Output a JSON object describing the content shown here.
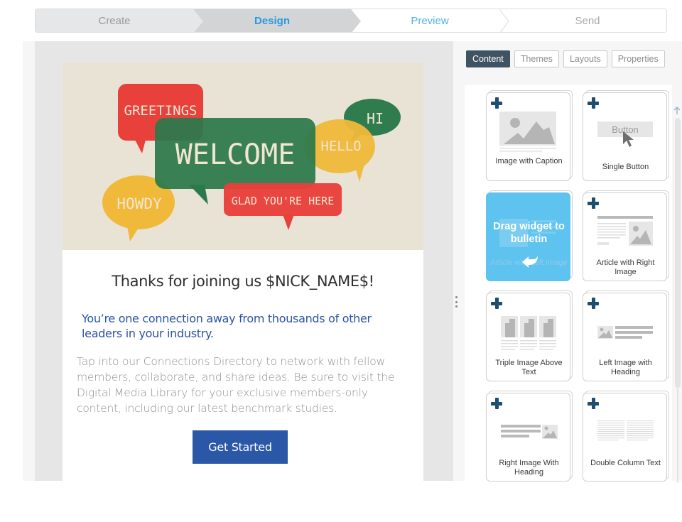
{
  "stepper": {
    "steps": [
      {
        "label": "Create",
        "state": "completed"
      },
      {
        "label": "Design",
        "state": "active"
      },
      {
        "label": "Preview",
        "state": "next"
      },
      {
        "label": "Send",
        "state": "upcoming"
      }
    ]
  },
  "email": {
    "hero_image": {
      "alt": "Welcome speech bubbles",
      "bubbles": [
        "GREETINGS",
        "WELCOME",
        "HELLO",
        "HI",
        "HOWDY",
        "GLAD YOU'RE HERE"
      ]
    },
    "title": "Thanks for joining us $NICK_NAME$!",
    "subtitle": "You’re one connection away from thousands of other leaders in your industry.",
    "body": "Tap into our Connections Directory to network with fellow members, collaborate, and share ideas. Be sure to visit the Digital Media Library for your exclusive members-only content, including our latest benchmark studies.",
    "cta_label": "Get Started"
  },
  "panel": {
    "tabs": [
      {
        "label": "Content",
        "active": true
      },
      {
        "label": "Themes",
        "active": false
      },
      {
        "label": "Layouts",
        "active": false
      },
      {
        "label": "Properties",
        "active": false
      }
    ],
    "drag_hint": "Drag widget to bulletin",
    "widgets": [
      {
        "label": "Image with Caption",
        "icon": "image-caption-icon"
      },
      {
        "label": "Single Button",
        "icon": "button-icon",
        "thumb_text": "Button"
      },
      {
        "label": "Article with Left Image",
        "icon": "article-left-image-icon",
        "state": "dragging"
      },
      {
        "label": "Article with Right Image",
        "icon": "article-right-image-icon"
      },
      {
        "label": "Triple Image Above Text",
        "icon": "triple-image-icon"
      },
      {
        "label": "Left Image with Heading",
        "icon": "left-image-heading-icon"
      },
      {
        "label": "Right Image With Heading",
        "icon": "right-image-heading-icon"
      },
      {
        "label": "Double Column Text",
        "icon": "double-column-icon"
      }
    ]
  },
  "colors": {
    "accent_blue": "#2a9ae0",
    "cta_blue": "#2a57a6",
    "subtitle_blue": "#2a53a6",
    "tab_active": "#3e5462",
    "drag_highlight": "#5ec3ef",
    "plus_icon": "#1d4e72"
  }
}
